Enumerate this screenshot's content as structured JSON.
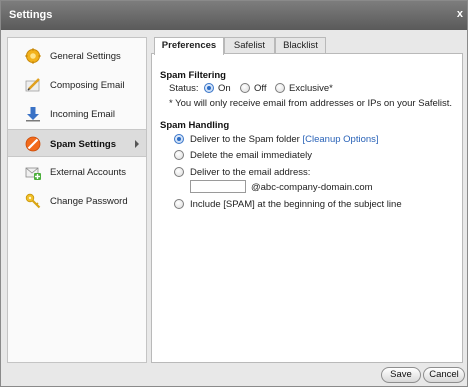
{
  "window": {
    "title": "Settings",
    "close_glyph": "x"
  },
  "sidebar": {
    "items": [
      {
        "label": "General Settings",
        "icon": "gear-icon"
      },
      {
        "label": "Composing Email",
        "icon": "pencil-icon"
      },
      {
        "label": "Incoming Email",
        "icon": "download-arrow-icon"
      },
      {
        "label": "Spam Settings",
        "icon": "no-entry-icon",
        "active": true
      },
      {
        "label": "External Accounts",
        "icon": "mail-add-icon"
      },
      {
        "label": "Change Password",
        "icon": "key-icon"
      }
    ]
  },
  "tabs": [
    {
      "label": "Preferences",
      "active": true
    },
    {
      "label": "Safelist"
    },
    {
      "label": "Blacklist"
    }
  ],
  "spam_filtering": {
    "title": "Spam Filtering",
    "status_label": "Status:",
    "options": [
      "On",
      "Off",
      "Exclusive*"
    ],
    "selected": "On",
    "note": "* You will only receive email from addresses or IPs on your Safelist."
  },
  "spam_handling": {
    "title": "Spam Handling",
    "deliver_spam_folder": "Deliver to the Spam folder",
    "cleanup_link": "[Cleanup Options]",
    "delete_immediately": "Delete the email immediately",
    "deliver_to_address": "Deliver to the email address:",
    "address_value": "",
    "domain_suffix": "@abc-company-domain.com",
    "include_spam_tag": "Include [SPAM] at the beginning of the subject line",
    "selected": "deliver_spam_folder"
  },
  "footer": {
    "save_label": "Save",
    "cancel_label": "Cancel"
  },
  "colors": {
    "accent": "#2b6cc4",
    "link": "#2a63b8",
    "titlebar": "#6b6b6b"
  }
}
